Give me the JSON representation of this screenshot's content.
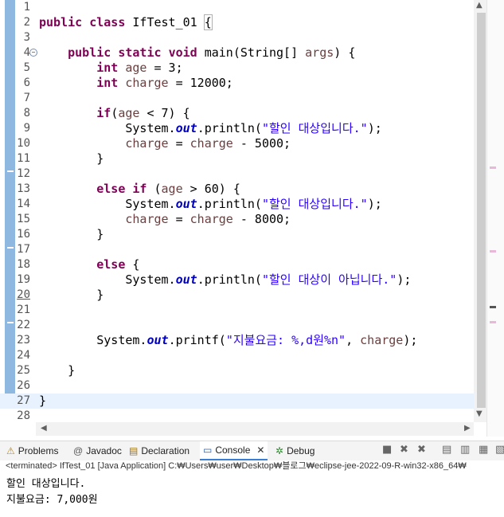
{
  "editor": {
    "lines": [
      {
        "n": "1",
        "code": ""
      },
      {
        "n": "2",
        "code": "public class IfTest_01 {"
      },
      {
        "n": "3",
        "code": ""
      },
      {
        "n": "4",
        "code": "    public static void main(String[] args) {"
      },
      {
        "n": "5",
        "code": "        int age = 3;"
      },
      {
        "n": "6",
        "code": "        int charge = 12000;"
      },
      {
        "n": "7",
        "code": ""
      },
      {
        "n": "8",
        "code": "        if(age < 7) {"
      },
      {
        "n": "9",
        "code": "            System.out.println(\"할인 대상입니다.\");"
      },
      {
        "n": "10",
        "code": "            charge = charge - 5000;"
      },
      {
        "n": "11",
        "code": "        }"
      },
      {
        "n": "12",
        "code": ""
      },
      {
        "n": "13",
        "code": "        else if (age > 60) {"
      },
      {
        "n": "14",
        "code": "            System.out.println(\"할인 대상입니다.\");"
      },
      {
        "n": "15",
        "code": "            charge = charge - 8000;"
      },
      {
        "n": "16",
        "code": "        }"
      },
      {
        "n": "17",
        "code": ""
      },
      {
        "n": "18",
        "code": "        else {"
      },
      {
        "n": "19",
        "code": "            System.out.println(\"할인 대상이 아닙니다.\");"
      },
      {
        "n": "20",
        "code": "        }"
      },
      {
        "n": "21",
        "code": ""
      },
      {
        "n": "22",
        "code": ""
      },
      {
        "n": "23",
        "code": "        System.out.printf(\"지불요금: %,d원%n\", charge);"
      },
      {
        "n": "24",
        "code": ""
      },
      {
        "n": "25",
        "code": "    }"
      },
      {
        "n": "26",
        "code": ""
      },
      {
        "n": "27",
        "code": "}"
      },
      {
        "n": "28",
        "code": ""
      }
    ]
  },
  "tabs": [
    {
      "label": "Problems",
      "icon": "problems-icon",
      "glyph": "⚠"
    },
    {
      "label": "Javadoc",
      "icon": "javadoc-icon",
      "glyph": "@"
    },
    {
      "label": "Declaration",
      "icon": "declaration-icon",
      "glyph": "▤"
    },
    {
      "label": "Console",
      "icon": "console-icon",
      "glyph": "▭",
      "close": "✕"
    },
    {
      "label": "Debug",
      "icon": "debug-icon",
      "glyph": "✲"
    }
  ],
  "console": {
    "header": "<terminated> IfTest_01 [Java Application] C:₩Users₩user₩Desktop₩블로그₩eclipse-jee-2022-09-R-win32-x86_64₩",
    "output": [
      "할인 대상입니다.",
      "지불요금: 7,000원"
    ]
  },
  "colors": {
    "keyword": "#7f0055",
    "string": "#2a00ff",
    "field": "#0000c0",
    "variable": "#6a3e3e",
    "accent": "#3b7fd4"
  }
}
